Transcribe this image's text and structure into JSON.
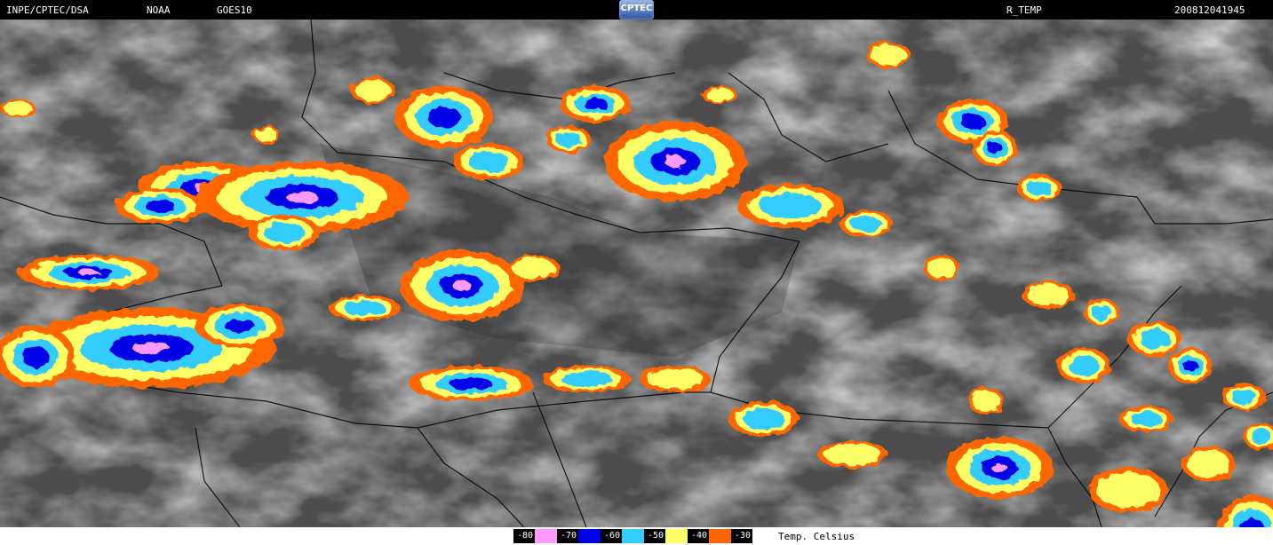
{
  "header": {
    "left": "INPE/CPTEC/DSA",
    "agency": "NOAA",
    "satellite": "GOES10",
    "logo": "CPTEC",
    "product": "R_TEMP",
    "timestamp": "200812041945"
  },
  "legend": {
    "unit_label": "Temp. Celsius",
    "entries": [
      {
        "value": "-80",
        "color": "#ff99ff"
      },
      {
        "value": "-70",
        "color": "#0000e6"
      },
      {
        "value": "-60",
        "color": "#33ccff"
      },
      {
        "value": "-50",
        "color": "#ffff66"
      },
      {
        "value": "-40",
        "color": "#ff6600"
      },
      {
        "value": "-30",
        "color": "#ffffff"
      }
    ]
  }
}
